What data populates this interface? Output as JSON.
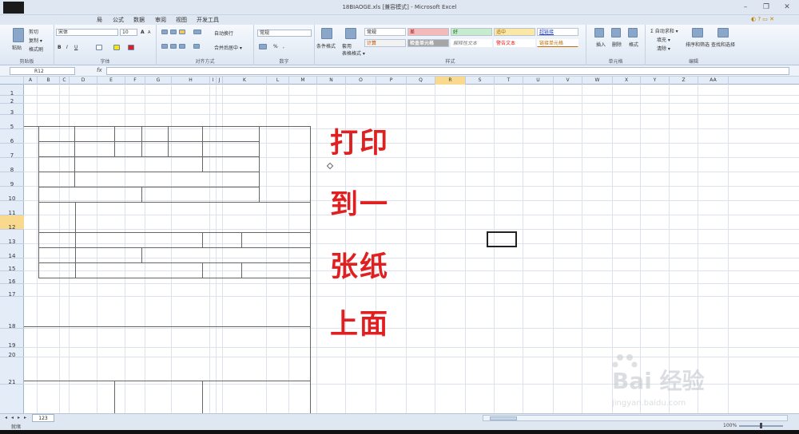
{
  "window": {
    "title": "18BIAOGE.xls [兼容模式] - Microsoft Excel",
    "controls": {
      "minimize": "–",
      "restore": "❐",
      "close": "✕"
    }
  },
  "ribbon": {
    "tabs": [
      "局",
      "公式",
      "数据",
      "审阅",
      "视图",
      "开发工具"
    ],
    "clipboard": {
      "paste": "粘贴",
      "cut": "剪切",
      "copy": "复制 ▾",
      "format_painter": "格式刷",
      "label": "剪贴板"
    },
    "font": {
      "name": "宋体",
      "size": "10",
      "bold": "B",
      "italic": "I",
      "underline": "U",
      "grow": "A",
      "shrink": "A",
      "label": "字体"
    },
    "alignment": {
      "wrap": "自动换行",
      "merge": "合并后居中 ▾",
      "label": "对齐方式"
    },
    "number": {
      "format": "常规",
      "percent": "%",
      "comma": ",",
      "label": "数字"
    },
    "styles": {
      "conditional": "条件格式",
      "table_format": "套用\n表格格式",
      "cells": [
        "常规",
        "差",
        "好",
        "适中",
        "超链接",
        "计算",
        "检查单元格",
        "解释性文本",
        "警告文本",
        "链接单元格"
      ],
      "label": "样式"
    },
    "cells_group": {
      "insert": "插入",
      "delete": "删除",
      "format": "格式",
      "label": "单元格"
    },
    "editing": {
      "autosum": "Σ 自动求和 ▾",
      "fill": "填充 ▾",
      "clear": "清除 ▾",
      "sort": "排序和筛选",
      "find": "查找和选择",
      "label": "编辑"
    }
  },
  "formula_bar": {
    "name_box": "R12",
    "fx": "fx",
    "value": ""
  },
  "columns": [
    "A",
    "B",
    "C",
    "D",
    "E",
    "F",
    "G",
    "H",
    "I",
    "J",
    "K",
    "L",
    "M",
    "N",
    "O",
    "P",
    "Q",
    "R",
    "S",
    "T",
    "U",
    "V",
    "W",
    "X",
    "Y",
    "Z",
    "AA"
  ],
  "rows": [
    "1",
    "2",
    "3",
    "5",
    "6",
    "7",
    "8",
    "9",
    "10",
    "11",
    "12",
    "13",
    "14",
    "15",
    "16",
    "17",
    "18",
    "19",
    "20",
    "21"
  ],
  "selected": {
    "column": "R",
    "row": "12"
  },
  "overlay_text": [
    "打印",
    "到一",
    "张纸",
    "上面"
  ],
  "sheet_tabs": [
    "123"
  ],
  "status": {
    "ready": "就绪",
    "zoom": "100%"
  },
  "watermark": {
    "brand": "Bai  经验",
    "url": "jingyan.baidu.com"
  }
}
